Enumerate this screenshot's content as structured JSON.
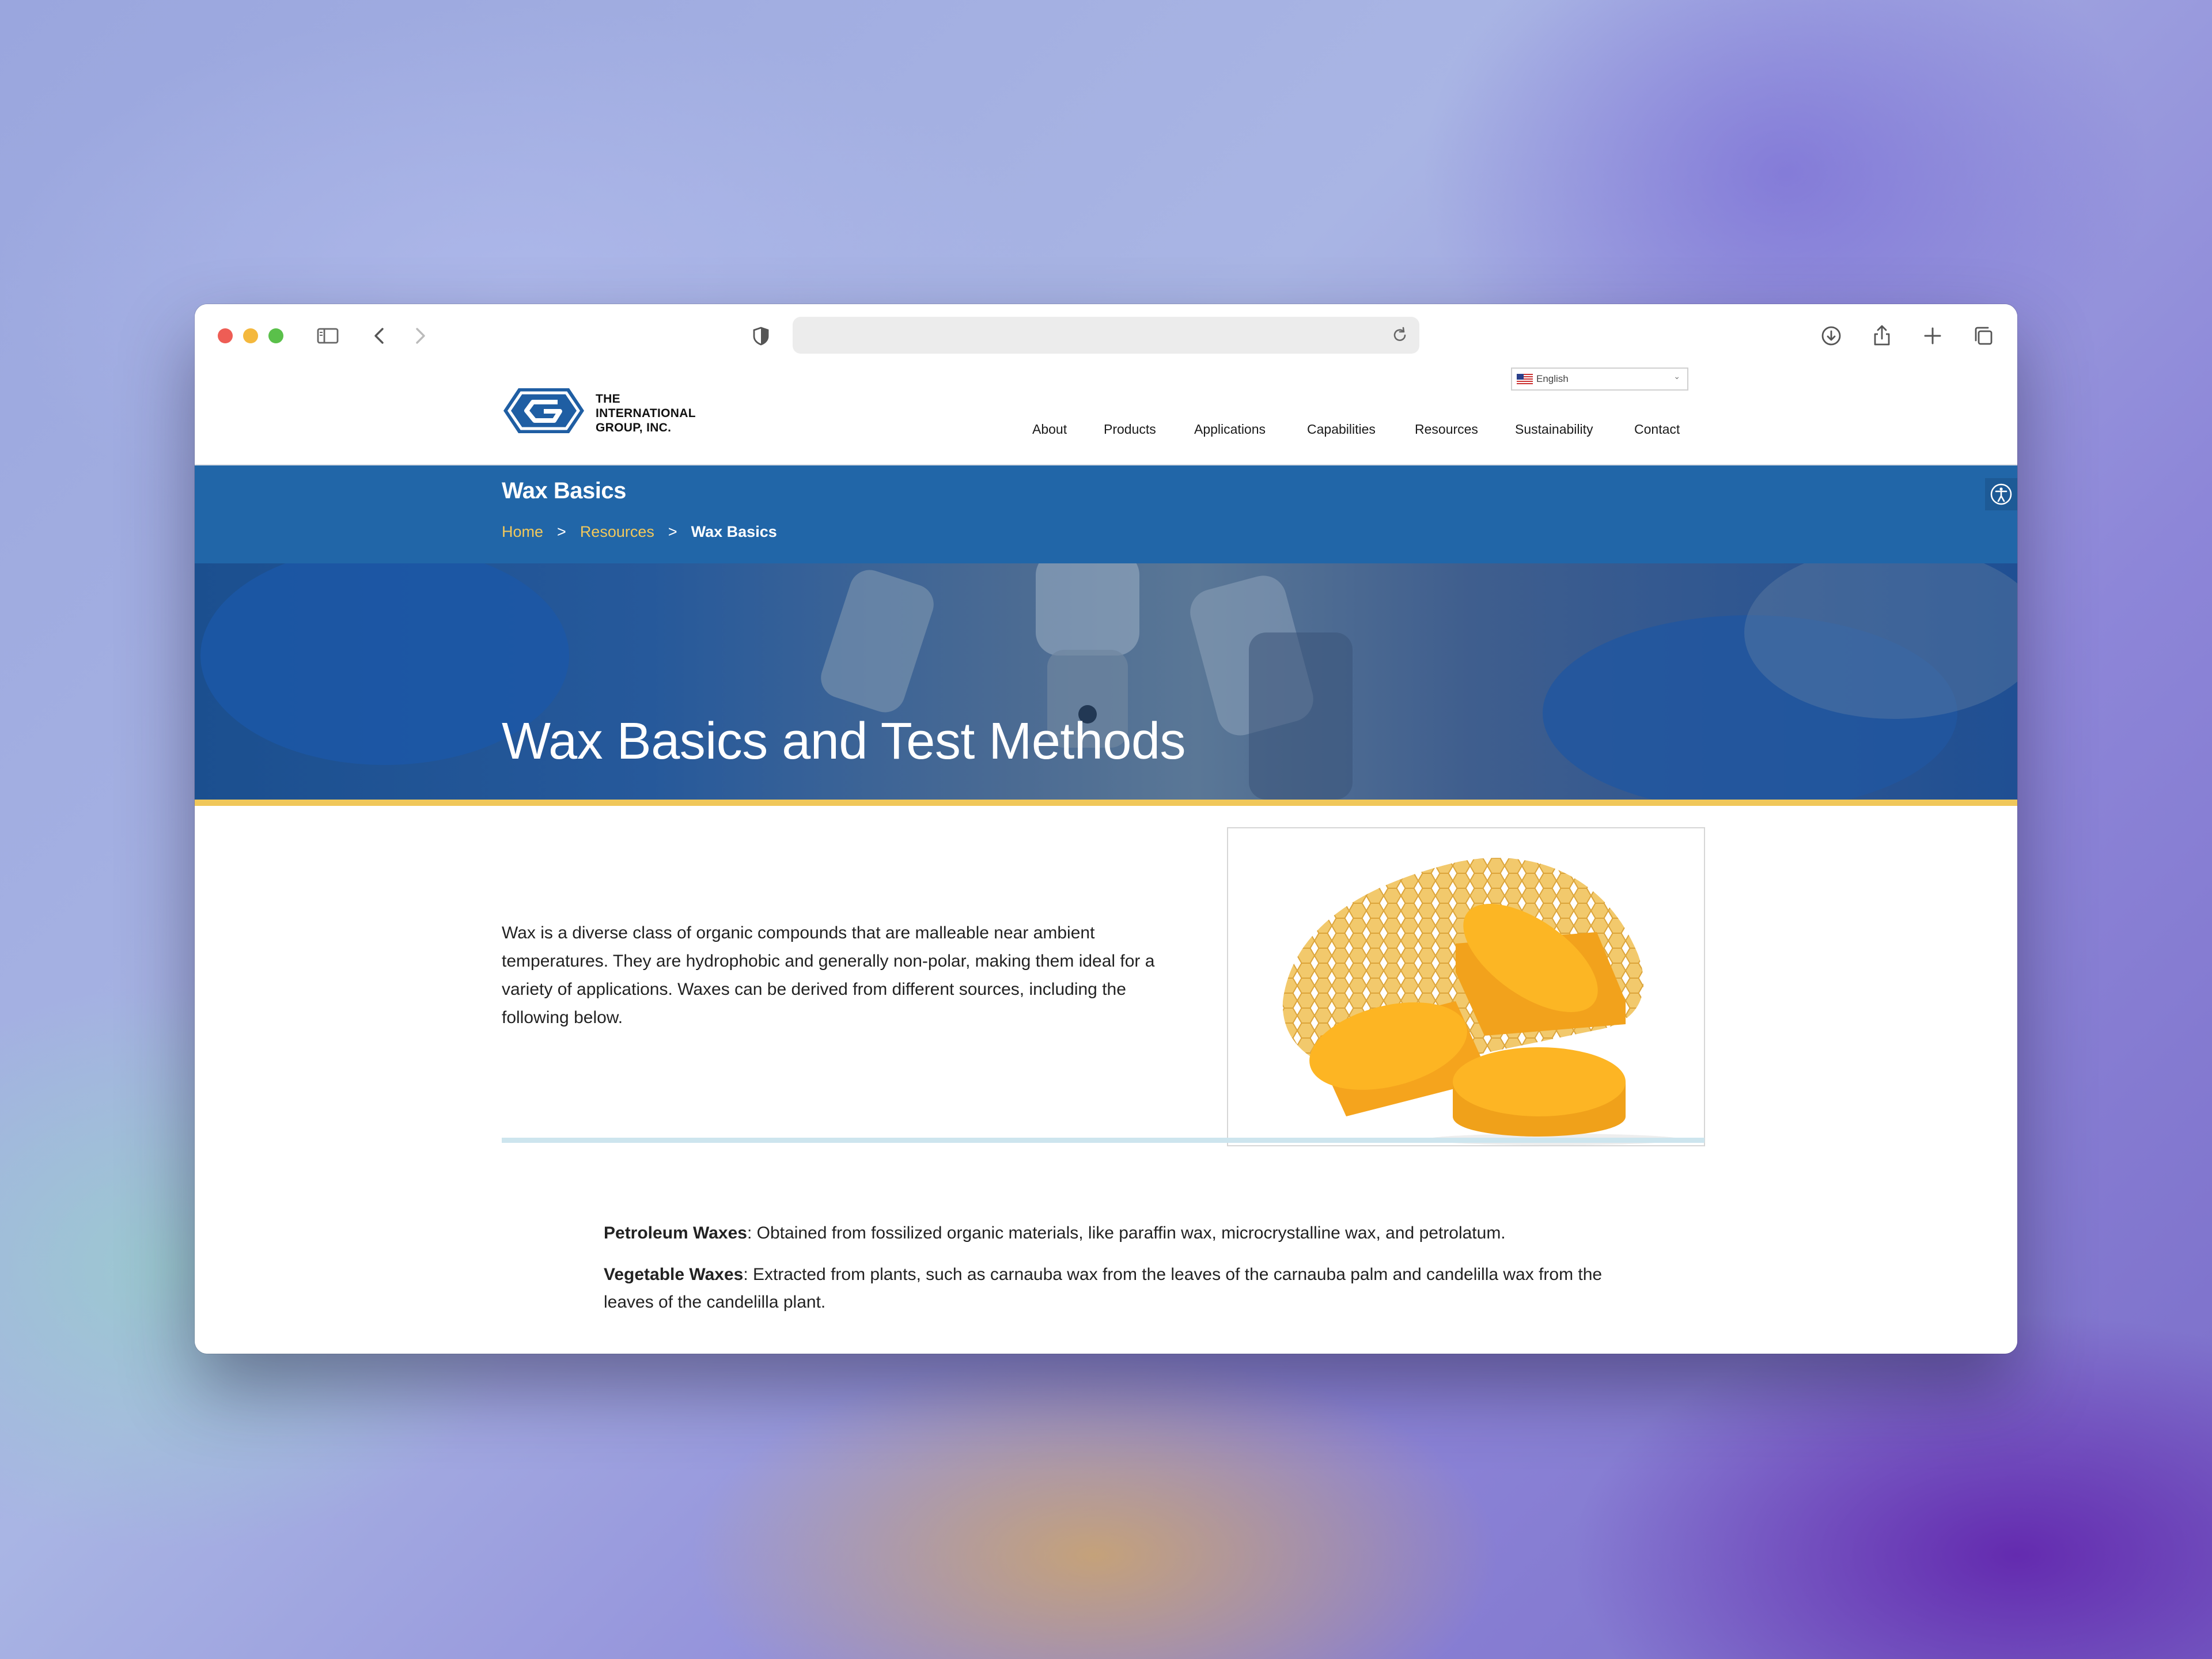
{
  "browser": {
    "url": "",
    "icons": [
      "sidebar-icon",
      "back-icon",
      "forward-icon",
      "shield-icon",
      "reload-icon",
      "download-icon",
      "share-icon",
      "new-tab-icon",
      "tabs-overview-icon"
    ]
  },
  "site": {
    "logo_lines": [
      "THE",
      "INTERNATIONAL",
      "GROUP, INC."
    ],
    "language": "English",
    "nav": [
      "About",
      "Products",
      "Applications",
      "Capabilities",
      "Resources",
      "Sustainability",
      "Contact"
    ]
  },
  "page_title": "Wax Basics",
  "breadcrumb": {
    "home": "Home",
    "sep": ">",
    "section": "Resources",
    "current": "Wax Basics"
  },
  "hero_title": "Wax Basics and Test Methods",
  "intro": "Wax is a diverse class of organic compounds that are malleable near ambient temperatures. They are hydrophobic and generally non-polar, making them ideal for a variety of applications. Waxes can be derived from different sources, including the following below.",
  "wax_types": [
    {
      "name": "Petroleum Waxes",
      "text": ": Obtained from fossilized organic materials, like paraffin wax, microcrystalline wax, and petrolatum."
    },
    {
      "name": "Vegetable Waxes",
      "text": ": Extracted from plants, such as carnauba wax from the leaves of the carnauba palm and candelilla wax from the leaves of the candelilla plant."
    }
  ],
  "colors": {
    "brand_blue": "#2166a8",
    "crumb_gold": "#f2c85b",
    "accent_gold": "#f0c75a",
    "divider": "#cde5ee"
  }
}
